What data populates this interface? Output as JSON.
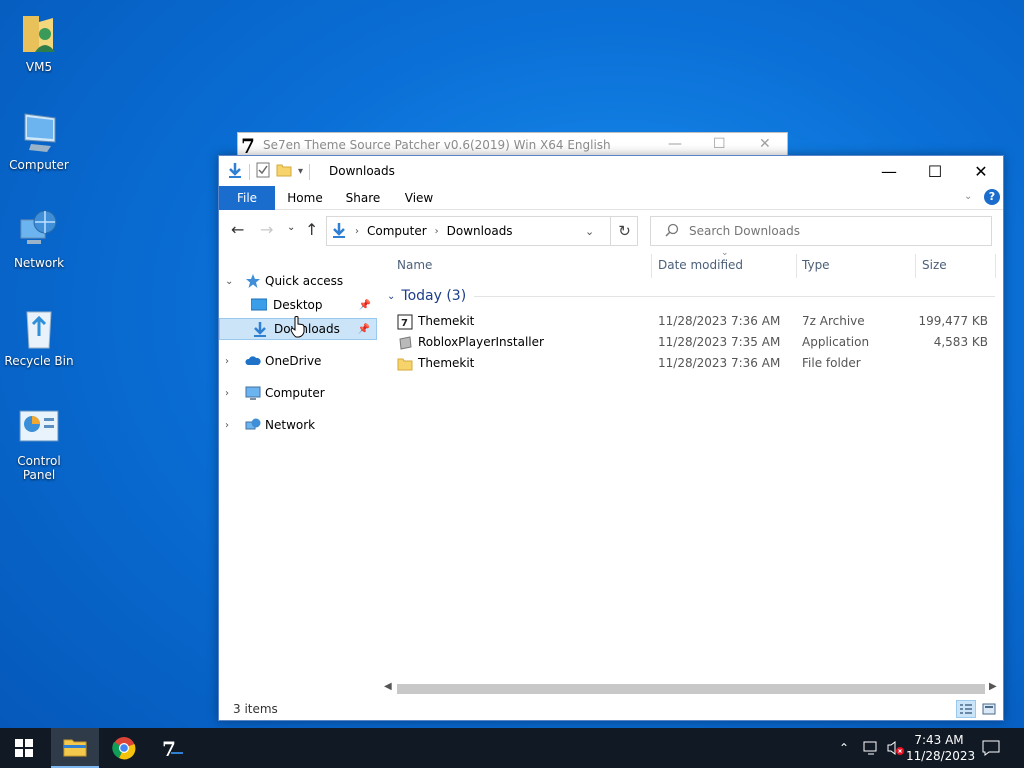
{
  "desktop": {
    "icons": [
      {
        "label": "VM5"
      },
      {
        "label": "Computer"
      },
      {
        "label": "Network"
      },
      {
        "label": "Recycle Bin"
      },
      {
        "label": "Control Panel"
      }
    ]
  },
  "bg_window": {
    "title": "Se7en Theme Source Patcher v0.6(2019) Win X64 English",
    "logo_text": "7"
  },
  "explorer": {
    "title": "Downloads",
    "ribbon_tabs": [
      "File",
      "Home",
      "Share",
      "View"
    ],
    "breadcrumb": [
      "Computer",
      "Downloads"
    ],
    "search_placeholder": "Search Downloads",
    "nav": {
      "quick_access": "Quick access",
      "desktop": "Desktop",
      "downloads": "Downloads",
      "onedrive": "OneDrive",
      "computer": "Computer",
      "network": "Network"
    },
    "columns": [
      "Name",
      "Date modified",
      "Type",
      "Size"
    ],
    "group_label": "Today (3)",
    "files": [
      {
        "name": "Themekit",
        "date": "11/28/2023 7:36 AM",
        "type": "7z Archive",
        "size": "199,477 KB"
      },
      {
        "name": "RobloxPlayerInstaller",
        "date": "11/28/2023 7:35 AM",
        "type": "Application",
        "size": "4,583 KB"
      },
      {
        "name": "Themekit",
        "date": "11/28/2023 7:36 AM",
        "type": "File folder",
        "size": ""
      }
    ],
    "status": "3 items"
  },
  "taskbar": {
    "time": "7:43 AM",
    "date": "11/28/2023"
  },
  "colors": {
    "accent": "#1a6dcc",
    "selection": "#cce4f7",
    "taskbar": "#111a24"
  }
}
